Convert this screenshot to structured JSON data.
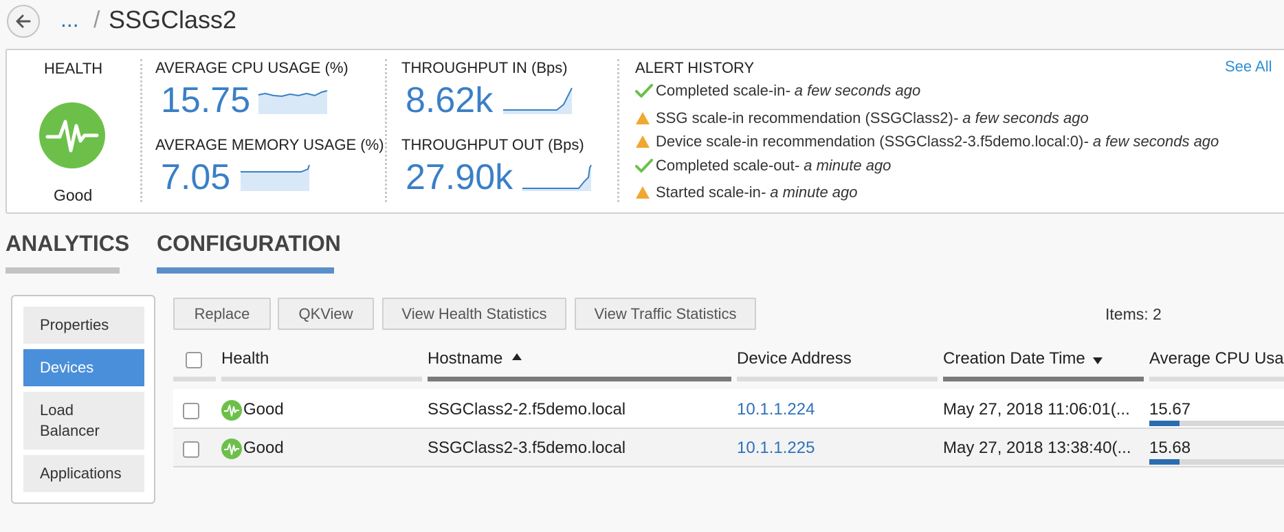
{
  "breadcrumb": {
    "ellipsis": "...",
    "separator": "/",
    "title": "SSGClass2"
  },
  "stats": {
    "health_label": "HEALTH",
    "health_state": "Good",
    "cpu_label": "AVERAGE CPU USAGE (%)",
    "cpu_value": "15.75",
    "mem_label": "AVERAGE MEMORY USAGE (%)",
    "mem_value": "7.05",
    "tin_label": "THROUGHPUT IN (Bps)",
    "tin_value": "8.62k",
    "tout_label": "THROUGHPUT OUT (Bps)",
    "tout_value": "27.90k"
  },
  "alerts": {
    "title": "ALERT HISTORY",
    "see_all": "See All",
    "items": [
      {
        "icon": "check-icon",
        "text": "Completed scale-in",
        "time": " - a few seconds ago"
      },
      {
        "icon": "warning-icon",
        "text": "SSG scale-in recommendation (SSGClass2)",
        "time": " - a few seconds ago"
      },
      {
        "icon": "warning-icon",
        "text": "Device scale-in recommendation (SSGClass2-3.f5demo.local:0)",
        "time": " - a few seconds ago"
      },
      {
        "icon": "check-icon",
        "text": "Completed scale-out",
        "time": " - a minute ago"
      },
      {
        "icon": "warning-icon",
        "text": "Started scale-in",
        "time": " - a minute ago"
      }
    ]
  },
  "tabs": {
    "analytics": "ANALYTICS",
    "configuration": "CONFIGURATION"
  },
  "sidenav": {
    "properties": "Properties",
    "devices": "Devices",
    "load_balancer_1": "Load",
    "load_balancer_2": "Balancer",
    "applications": "Applications"
  },
  "toolbar": {
    "replace": "Replace",
    "qkview": "QKView",
    "health_stats": "View Health Statistics",
    "traffic_stats": "View Traffic Statistics",
    "items_count": "Items: 2"
  },
  "table": {
    "headers": {
      "health": "Health",
      "hostname": "Hostname",
      "address": "Device Address",
      "created": "Creation Date Time",
      "cpu": "Average CPU Usage"
    },
    "rows": [
      {
        "health": "Good",
        "hostname": "SSGClass2-2.f5demo.local",
        "address": "10.1.1.224",
        "created": "May 27, 2018 11:06:01(...",
        "cpu": "15.67"
      },
      {
        "health": "Good",
        "hostname": "SSGClass2-3.f5demo.local",
        "address": "10.1.1.225",
        "created": "May 27, 2018 13:38:40(...",
        "cpu": "15.68"
      }
    ]
  },
  "colors": {
    "accent": "#3a7fc6",
    "health_good": "#6cc04a",
    "warning": "#f0a830",
    "nav_active": "#4a8fd9",
    "link": "#2d72b8"
  }
}
